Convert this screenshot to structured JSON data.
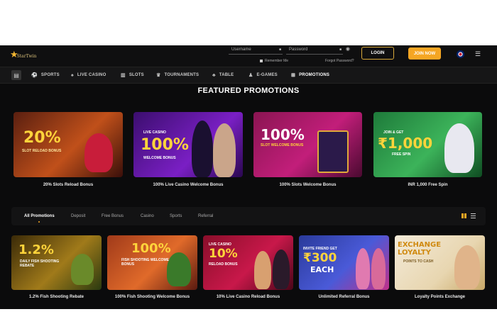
{
  "header": {
    "logo_text": "StarTwin",
    "username_placeholder": "Username",
    "password_placeholder": "Password",
    "remember_me": "Remember Me",
    "forgot_password": "Forgot Password?",
    "login_label": "LOGIN",
    "join_label": "JOIN NOW"
  },
  "nav": {
    "items": [
      {
        "label": "SPORTS",
        "icon": "soccer-ball-icon"
      },
      {
        "label": "LIVE CASINO",
        "icon": "dealer-icon"
      },
      {
        "label": "SLOTS",
        "icon": "slot-icon"
      },
      {
        "label": "TOURNAMENTS",
        "icon": "trophy-icon"
      },
      {
        "label": "TABLE",
        "icon": "table-icon"
      },
      {
        "label": "E-GAMES",
        "icon": "person-icon"
      },
      {
        "label": "PROMOTIONS",
        "icon": "gift-icon"
      }
    ]
  },
  "featured": {
    "title": "FEATURED PROMOTIONS",
    "cards": [
      {
        "big": "20%",
        "sub": "SLOT RELOAD BONUS",
        "caption": "20% Slots Reload Bonus"
      },
      {
        "top": "LIVE CASINO",
        "big": "100%",
        "sub": "WELCOME BONUS",
        "caption": "100% Live Casino Welcome Bonus"
      },
      {
        "big": "100%",
        "sub": "SLOT WELCOME BONUS",
        "caption": "100% Slots Welcome Bonus"
      },
      {
        "top": "JOIN & GET",
        "big": "₹1,000",
        "sub": "FREE SPIN",
        "caption": "INR 1,000 Free Spin"
      }
    ]
  },
  "tabs": {
    "items": [
      "All Promotions",
      "Deposit",
      "Free Bonus",
      "Casino",
      "Sports",
      "Referral"
    ]
  },
  "promos": {
    "cards": [
      {
        "big": "1.2%",
        "sub": "DAILY FISH SHOOTING REBATE",
        "caption": "1.2% Fish Shooting Rebate"
      },
      {
        "big": "100%",
        "sub": "FISH SHOOTING WELCOME BONUS",
        "caption": "100% Fish Shooting Welcome Bonus"
      },
      {
        "top": "LIVE CASINO",
        "big": "10%",
        "sub": "RELOAD BONUS",
        "caption": "10% Live Casino Reload Bonus"
      },
      {
        "top": "INVITE FRIEND GET",
        "big": "₹300",
        "sub": "EACH",
        "caption": "Unlimited Referral Bonus"
      },
      {
        "big": "EXCHANGE LOYALTY",
        "sub": "POINTS TO CASH",
        "caption": "Loyalty Points Exchange"
      }
    ]
  },
  "colors": {
    "accent": "#f5a623",
    "background": "#0b0b0c"
  }
}
